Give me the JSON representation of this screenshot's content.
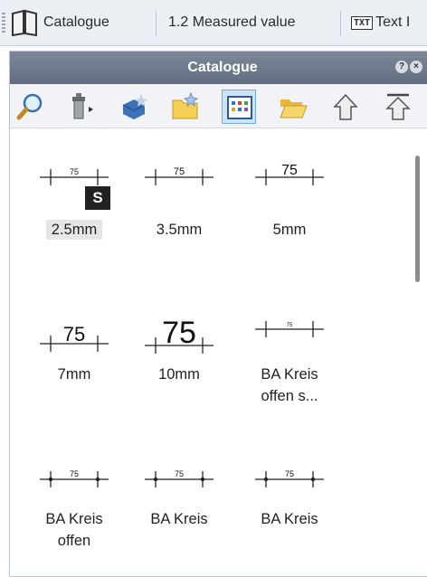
{
  "tabs": [
    {
      "label": "Catalogue"
    },
    {
      "label": "1.2 Measured value"
    },
    {
      "label": "Text I",
      "badge": "TXT"
    }
  ],
  "panel": {
    "title": "Catalogue",
    "toolbar_icons": [
      "search-icon",
      "wizard-icon",
      "paint-bucket-icon",
      "folder-star-icon",
      "grid-view-icon",
      "open-folder-icon",
      "arrow-up-icon",
      "arrow-up-double-icon"
    ],
    "active_tool": "grid-view-icon"
  },
  "items": [
    {
      "label": "2.5mm",
      "value": "75",
      "selected": true,
      "badge": "S"
    },
    {
      "label": "3.5mm",
      "value": "75"
    },
    {
      "label": "5mm",
      "value": "75"
    },
    {
      "label": "7mm",
      "value": "75"
    },
    {
      "label": "10mm",
      "value": "75"
    },
    {
      "label": "BA Kreis",
      "label2": "offen s...",
      "value": "75"
    },
    {
      "label": "BA Kreis",
      "label2": "offen",
      "value": "75"
    },
    {
      "label": "BA Kreis",
      "label2": "",
      "value": "75"
    },
    {
      "label": "BA Kreis",
      "label2": "",
      "value": "75"
    }
  ]
}
